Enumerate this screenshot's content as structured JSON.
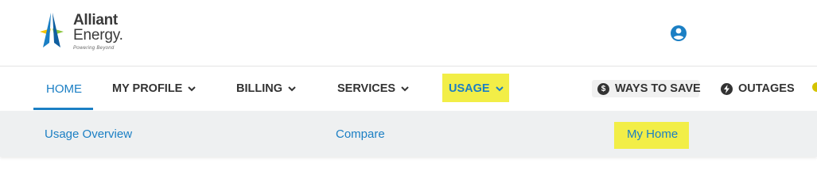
{
  "brand": {
    "name_line1": "Alliant",
    "name_line2": "Energy.",
    "tagline": "Powering Beyond",
    "colors": {
      "blue": "#1b7fc4",
      "green": "#8cc63f",
      "yellow": "#f2ee47"
    }
  },
  "header": {
    "account_icon": "account-circle-icon"
  },
  "nav": {
    "items": [
      {
        "label": "HOME",
        "active": true
      },
      {
        "label": "MY PROFILE",
        "dropdown": true
      },
      {
        "label": "BILLING",
        "dropdown": true
      },
      {
        "label": "SERVICES",
        "dropdown": true
      },
      {
        "label": "USAGE",
        "dropdown": true,
        "highlighted": true
      },
      {
        "label": "WAYS TO SAVE",
        "icon": "dollar-circle-icon"
      },
      {
        "label": "OUTAGES",
        "icon": "lightning-circle-icon"
      }
    ]
  },
  "subnav": {
    "items": [
      {
        "label": "Usage Overview"
      },
      {
        "label": "Compare"
      },
      {
        "label": "My Home",
        "highlighted": true
      }
    ]
  }
}
